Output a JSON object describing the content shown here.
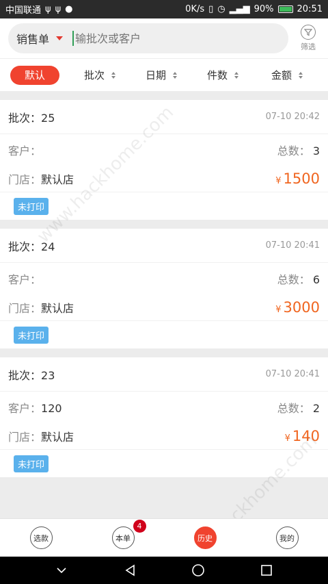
{
  "status_bar": {
    "carrier": "中国联通",
    "speed": "0K/s",
    "battery": "90%",
    "time": "20:51"
  },
  "search": {
    "doc_type": "销售单",
    "placeholder": "输批次或客户",
    "filter_label": "筛选"
  },
  "sort_bar": {
    "default_label": "默认",
    "items": [
      {
        "label": "批次"
      },
      {
        "label": "日期"
      },
      {
        "label": "件数"
      },
      {
        "label": "金额"
      }
    ]
  },
  "labels": {
    "batch": "批次：",
    "customer": "客户：",
    "total": "总数：",
    "store": "门店：",
    "currency": "¥"
  },
  "orders": [
    {
      "batch": "25",
      "time": "07-10 20:42",
      "customer": "",
      "total": "3",
      "store": "默认店",
      "amount": "1500",
      "status": "未打印"
    },
    {
      "batch": "24",
      "time": "07-10 20:41",
      "customer": "",
      "total": "6",
      "store": "默认店",
      "amount": "3000",
      "status": "未打印"
    },
    {
      "batch": "23",
      "time": "07-10 20:41",
      "customer": "120",
      "total": "2",
      "store": "默认店",
      "amount": "140",
      "status": "未打印"
    }
  ],
  "tabs": [
    {
      "label": "选款"
    },
    {
      "label": "本单",
      "badge": "4"
    },
    {
      "label": "历史"
    },
    {
      "label": "我的"
    }
  ],
  "watermark": "www.hackhome.com",
  "colors": {
    "accent": "#f0432f",
    "amount": "#f0651f",
    "badge": "#5ab1ec"
  }
}
